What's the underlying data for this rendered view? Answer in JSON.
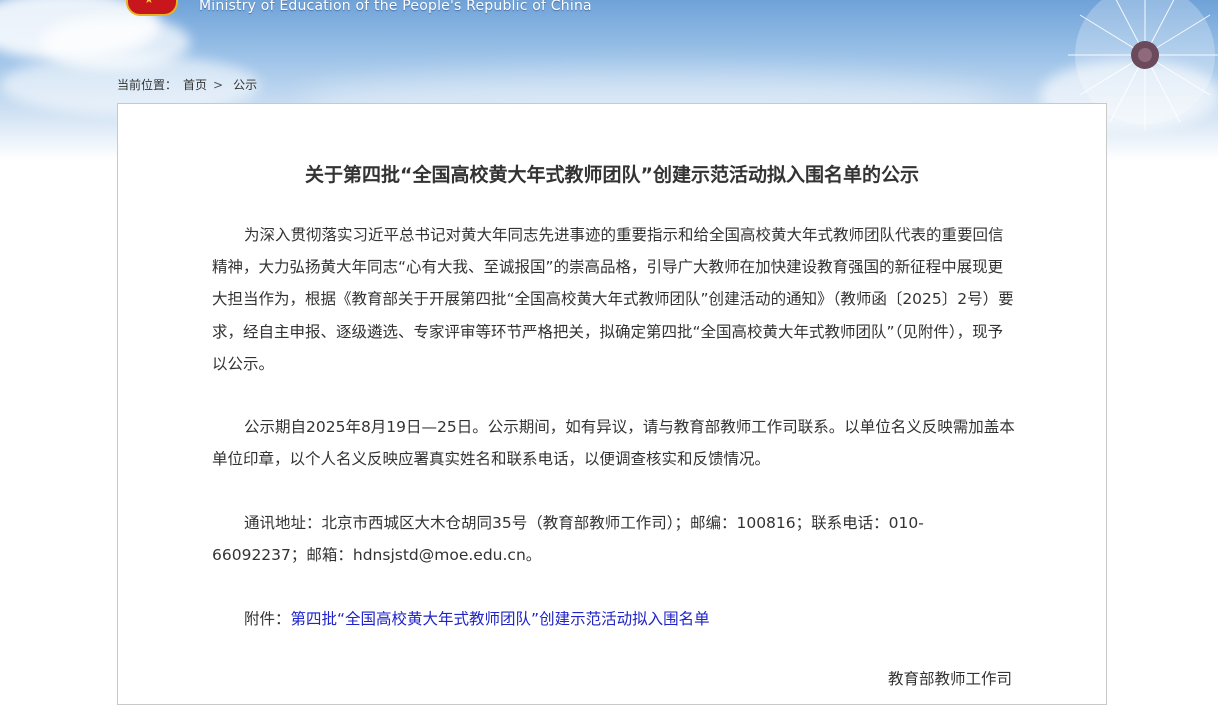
{
  "header": {
    "site_title_en": "Ministry of Education of the People's Republic of China"
  },
  "breadcrumb": {
    "prefix": "当前位置：",
    "home": "首页",
    "separator": ">",
    "current": "公示"
  },
  "article": {
    "title": "关于第四批“全国高校黄大年式教师团队”创建示范活动拟入围名单的公示",
    "paragraph1": "为深入贯彻落实习近平总书记对黄大年同志先进事迹的重要指示和给全国高校黄大年式教师团队代表的重要回信精神，大力弘扬黄大年同志“心有大我、至诚报国”的崇高品格，引导广大教师在加快建设教育强国的新征程中展现更大担当作为，根据《教育部关于开展第四批“全国高校黄大年式教师团队”创建活动的通知》（教师函〔2025〕2号）要求，经自主申报、逐级遴选、专家评审等环节严格把关，拟确定第四批“全国高校黄大年式教师团队”（见附件），现予以公示。",
    "paragraph2": "公示期自2025年8月19日—25日。公示期间，如有异议，请与教育部教师工作司联系。以单位名义反映需加盖本单位印章，以个人名义反映应署真实姓名和联系电话，以便调查核实和反馈情况。",
    "paragraph3": "通讯地址：北京市西城区大木仓胡同35号（教育部教师工作司）；邮编：100816；联系电话：010-66092237；邮箱：hdnsjstd@moe.edu.cn。",
    "attachment_label": "附件：",
    "attachment_link": "第四批“全国高校黄大年式教师团队”创建示范活动拟入围名单",
    "signer": "教育部教师工作司"
  },
  "colors": {
    "link": "#1f23c8",
    "emblem_red": "#c8161d",
    "sky_blue": "#6fa2d8"
  }
}
